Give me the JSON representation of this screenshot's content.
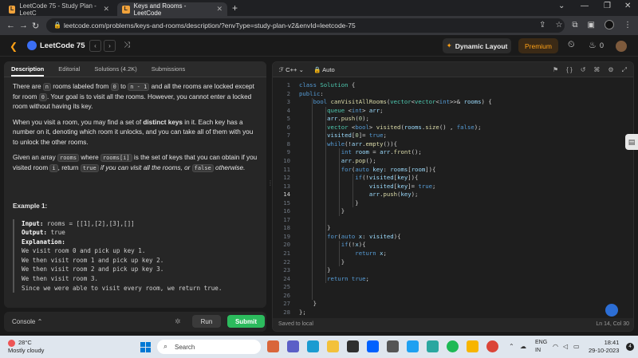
{
  "browser": {
    "tabs": [
      {
        "title": "LeetCode 75 - Study Plan - LeetC"
      },
      {
        "title": "Keys and Rooms - LeetCode"
      }
    ],
    "url": "leetcode.com/problems/keys-and-rooms/description/?envType=study-plan-v2&envId=leetcode-75"
  },
  "header": {
    "title": "LeetCode 75",
    "dynamic_layout": "Dynamic Layout",
    "premium": "Premium",
    "streak": "0"
  },
  "problem": {
    "tabs": [
      "Description",
      "Editorial",
      "Solutions (4.2K)",
      "Submissions"
    ],
    "p1_a": "There are ",
    "p1_n": "n",
    "p1_b": " rooms labeled from ",
    "p1_0": "0",
    "p1_c": " to ",
    "p1_n1": "n - 1",
    "p1_d": " and all the rooms are locked except for room ",
    "p1_r0": "0",
    "p1_e": ". Your goal is to visit all the rooms. However, you cannot enter a locked room without having its key.",
    "p2_a": "When you visit a room, you may find a set of ",
    "p2_b": "distinct keys",
    "p2_c": " in it. Each key has a number on it, denoting which room it unlocks, and you can take all of them with you to unlock the other rooms.",
    "p3_a": "Given an array ",
    "p3_rooms": "rooms",
    "p3_b": " where ",
    "p3_roomsi": "rooms[i]",
    "p3_c": " is the set of keys that you can obtain if you visited room ",
    "p3_i": "i",
    "p3_d": ", return ",
    "p3_true": "true",
    "p3_e": " if you can visit all the rooms, or ",
    "p3_false": "false",
    "p3_f": "otherwise.",
    "example_title": "Example 1:",
    "ex_input_label": "Input:",
    "ex_input": " rooms = [[1],[2],[3],[]]",
    "ex_output_label": "Output:",
    "ex_output": " true",
    "ex_expl_label": "Explanation:",
    "ex_lines": [
      "We visit room 0 and pick up key 1.",
      "We then visit room 1 and pick up key 2.",
      "We then visit room 2 and pick up key 3.",
      "We then visit room 3.",
      "Since we were able to visit every room, we return true."
    ]
  },
  "actions": {
    "console": "Console",
    "run": "Run",
    "submit": "Submit"
  },
  "editor": {
    "language": "C++",
    "mode": "Auto",
    "saved": "Saved to local",
    "position": "Ln 14, Col 30",
    "line_numbers": [
      "1",
      "2",
      "3",
      "4",
      "5",
      "6",
      "7",
      "8",
      "9",
      "10",
      "11",
      "12",
      "13",
      "14",
      "15",
      "16",
      "17",
      "18",
      "19",
      "20",
      "21",
      "22",
      "23",
      "24",
      "25",
      "26",
      "27",
      "28"
    ]
  },
  "taskbar": {
    "temp": "28°C",
    "weather": "Mostly cloudy",
    "search": "Search",
    "lang1": "ENG",
    "lang2": "IN",
    "time": "18:41",
    "date": "29-10-2023"
  }
}
